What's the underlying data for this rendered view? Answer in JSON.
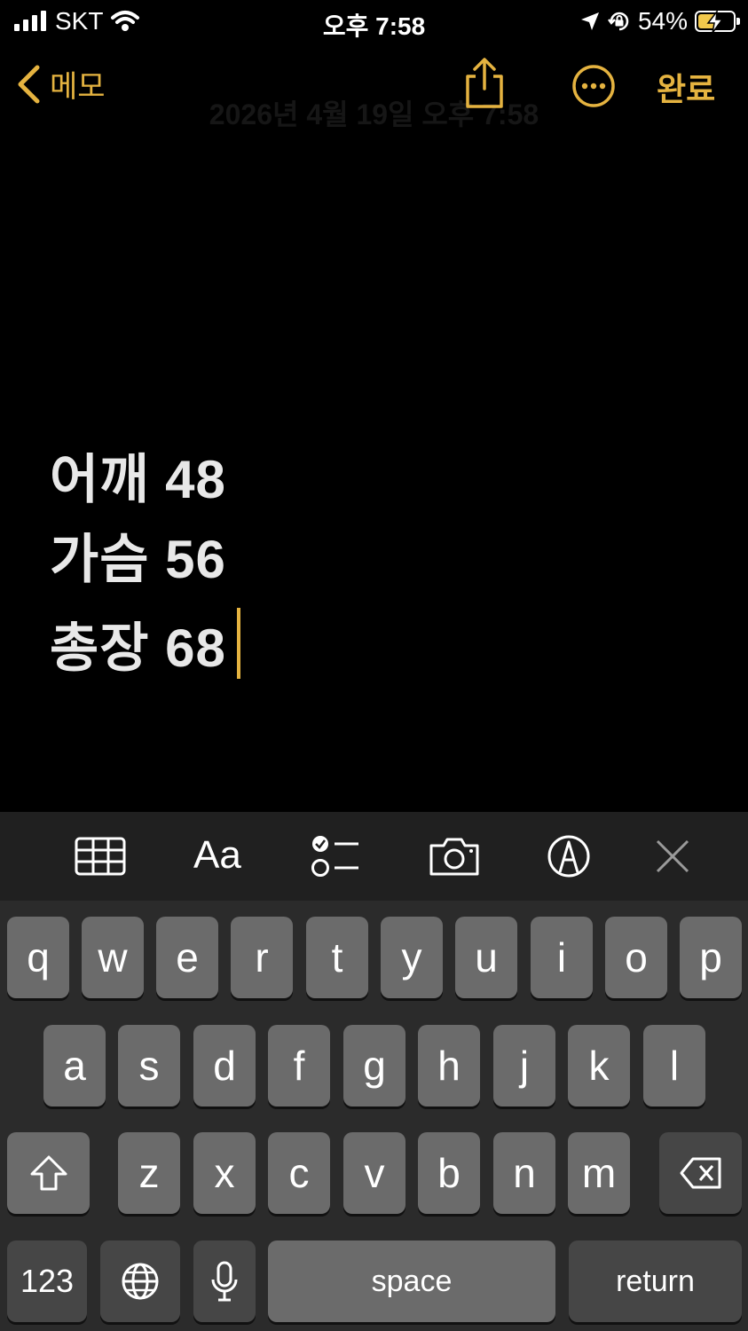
{
  "status_bar": {
    "carrier": "SKT",
    "time": "오후 7:58",
    "battery_percent": "54%",
    "battery_level": 0.54
  },
  "nav": {
    "back_label": "메모",
    "done_label": "완료",
    "date": "2026년 4월 19일 오후 7:58"
  },
  "note": {
    "lines": [
      "어깨 48",
      "가슴 56",
      "총장 68"
    ]
  },
  "toolbar": {
    "format_label": "Aa"
  },
  "keyboard": {
    "row1": [
      "q",
      "w",
      "e",
      "r",
      "t",
      "y",
      "u",
      "i",
      "o",
      "p"
    ],
    "row2": [
      "a",
      "s",
      "d",
      "f",
      "g",
      "h",
      "j",
      "k",
      "l"
    ],
    "row3": [
      "z",
      "x",
      "c",
      "v",
      "b",
      "n",
      "m"
    ],
    "numbers_label": "123",
    "space_label": "space",
    "return_label": "return"
  },
  "colors": {
    "accent": "#e5b340",
    "background": "#000000",
    "keyboard_bg": "#2b2b2b",
    "key": "#6b6b6b",
    "key_dark": "#464646"
  }
}
